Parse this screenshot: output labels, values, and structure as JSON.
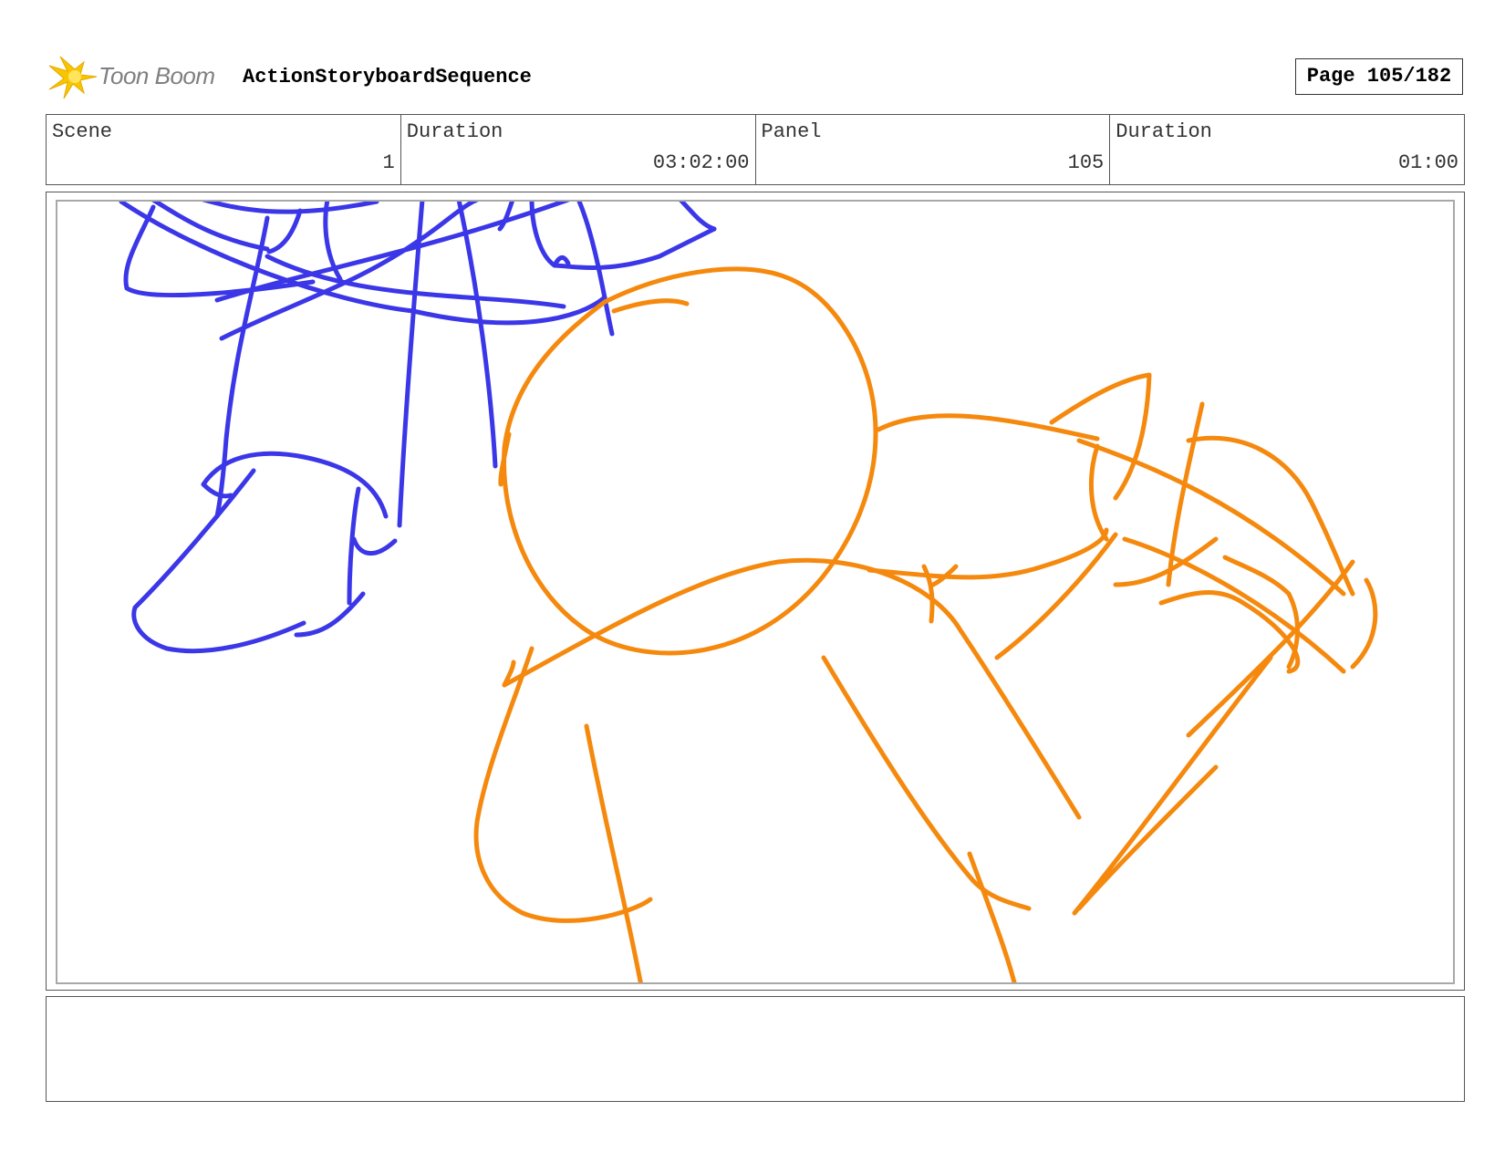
{
  "header": {
    "logo_text": "Toon Boom",
    "title": "ActionStoryboardSequence",
    "page_label": "Page 105/182"
  },
  "info": {
    "scene_label": "Scene",
    "scene_value": "1",
    "scene_duration_label": "Duration",
    "scene_duration_value": "03:02:00",
    "panel_label": "Panel",
    "panel_value": "105",
    "panel_duration_label": "Duration",
    "panel_duration_value": "01:00"
  },
  "colors": {
    "sketch_blue": "#3b37e8",
    "sketch_orange": "#f5890e",
    "logo_yellow": "#f7c600",
    "border": "#555555"
  },
  "notes": {
    "text": ""
  }
}
